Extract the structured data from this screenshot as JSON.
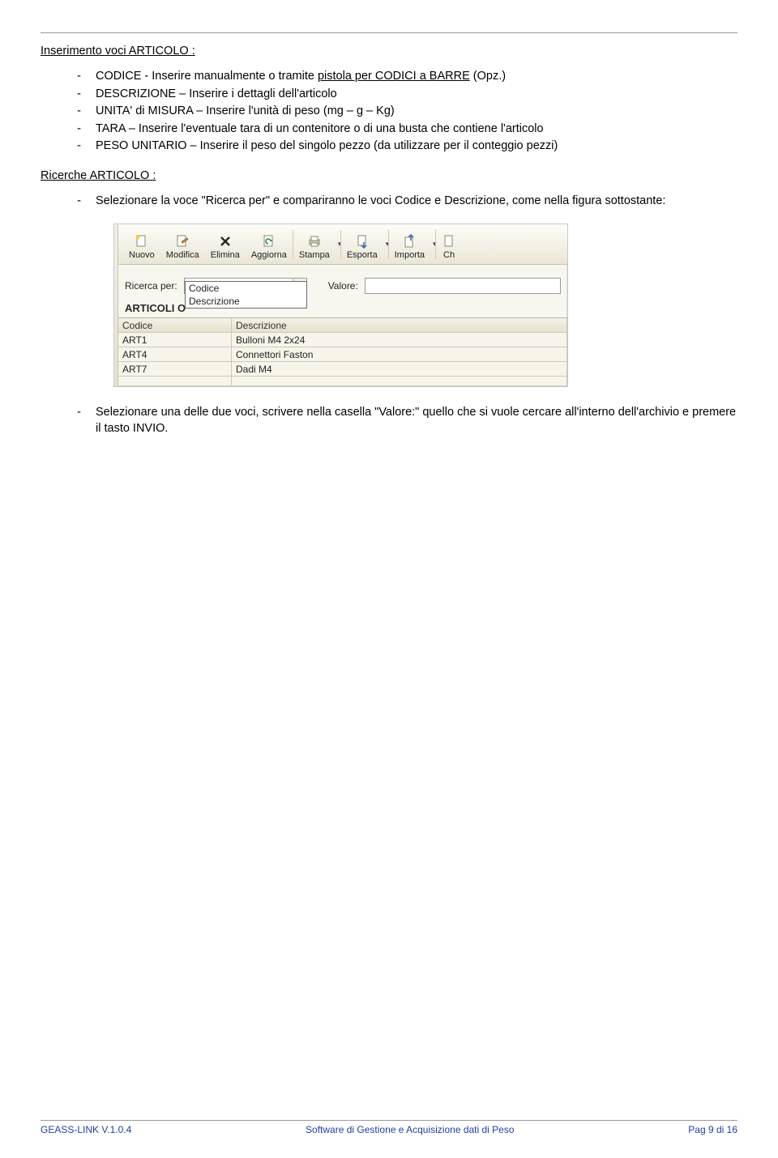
{
  "sections": {
    "insert_title": "Inserimento voci ARTICOLO :",
    "search_title": "Ricerche ARTICOLO :"
  },
  "insert_items": {
    "i0a": "CODICE - Inserire manualmente o tramite ",
    "i0b": "pistola per CODICI a BARRE",
    "i0c": " (Opz.)",
    "i1": "DESCRIZIONE – Inserire i dettagli dell'articolo",
    "i2": "UNITA' di MISURA – Inserire l'unità di peso (mg – g – Kg)",
    "i3": "TARA – Inserire l'eventuale tara di un contenitore o di una busta che contiene l'articolo",
    "i4": "PESO UNITARIO – Inserire il peso del singolo pezzo (da utilizzare per il conteggio pezzi)"
  },
  "search_items": {
    "s0": "Selezionare la voce \"Ricerca per\" e compariranno le voci Codice e Descrizione, come nella figura sottostante:",
    "s1": "Selezionare una delle due voci, scrivere nella casella \"Valore:\" quello che si vuole cercare all'interno dell'archivio e premere il tasto INVIO."
  },
  "screenshot": {
    "toolbar": [
      {
        "label": "Nuovo"
      },
      {
        "label": "Modifica"
      },
      {
        "label": "Elimina"
      },
      {
        "label": "Aggiorna"
      },
      {
        "label": "Stampa"
      },
      {
        "label": "Esporta"
      },
      {
        "label": "Importa"
      },
      {
        "label": "Ch"
      }
    ],
    "search_label": "Ricerca per:",
    "value_label": "Valore:",
    "dropdown_options": [
      "Codice",
      "Descrizione"
    ],
    "grid_heading_prefix": "ARTICOLI O",
    "columns": [
      "Codice",
      "Descrizione"
    ],
    "rows": [
      {
        "c": "ART1",
        "d": "Bulloni M4 2x24"
      },
      {
        "c": "ART4",
        "d": "Connettori Faston"
      },
      {
        "c": "ART7",
        "d": "Dadi M4"
      }
    ]
  },
  "footer": {
    "left": "GEASS-LINK V.1.0.4",
    "center": "Software di Gestione e Acquisizione dati di Peso",
    "right": "Pag 9 di 16"
  }
}
